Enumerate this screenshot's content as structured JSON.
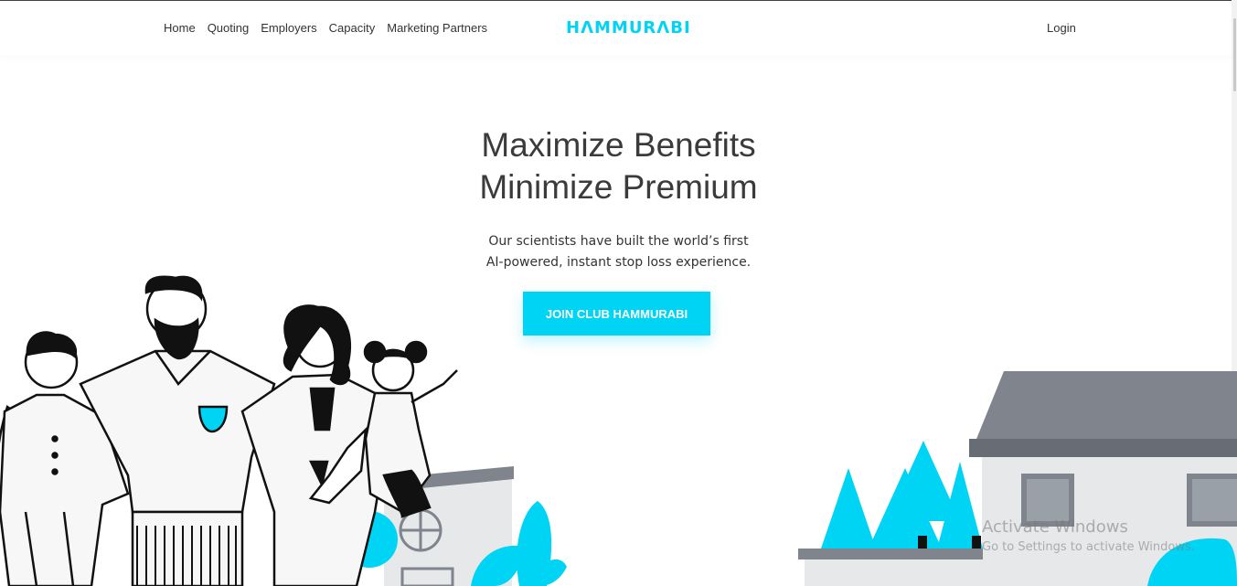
{
  "nav": {
    "items": [
      {
        "label": "Home"
      },
      {
        "label": "Quoting"
      },
      {
        "label": "Employers"
      },
      {
        "label": "Capacity"
      },
      {
        "label": "Marketing Partners"
      }
    ],
    "login": "Login"
  },
  "brand": {
    "name": "HΛMMURΛBI",
    "color": "#00d4f5"
  },
  "hero": {
    "headline_line1": "Maximize Benefits",
    "headline_line2": "Minimize Premium",
    "subtitle_line1": "Our scientists have built the world’s first",
    "subtitle_line2": "AI-powered, instant stop loss experience.",
    "cta_label": "JOIN CLUB HAMMURABI"
  },
  "watermark": {
    "title": "Activate Windows",
    "subtitle": "Go to Settings to activate Windows."
  },
  "colors": {
    "accent": "#00d4f5",
    "roof": "#7f848d",
    "wall": "#e6e8ea",
    "ink": "#111111"
  }
}
